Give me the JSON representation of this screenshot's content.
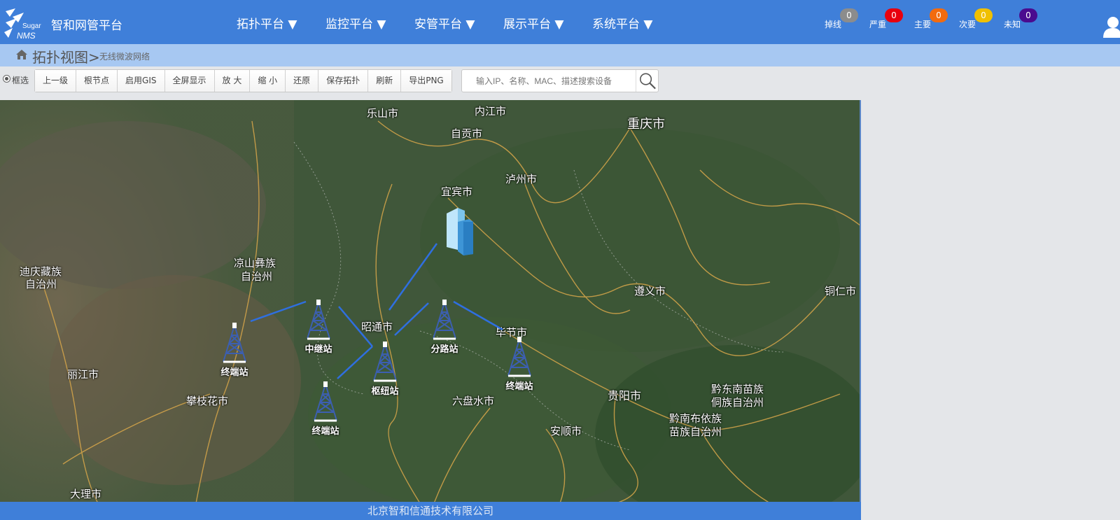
{
  "app": {
    "title": "智和网管平台",
    "logo_text_1": "Sugar",
    "logo_text_2": "NMS"
  },
  "nav": [
    {
      "label": "拓扑平台 ▼"
    },
    {
      "label": "监控平台 ▼"
    },
    {
      "label": "安管平台 ▼"
    },
    {
      "label": "展示平台 ▼"
    },
    {
      "label": "系统平台 ▼"
    }
  ],
  "alarms": [
    {
      "label": "掉线",
      "count": "0",
      "color": "#8c8c8c"
    },
    {
      "label": "严重",
      "count": "0",
      "color": "#e8000d"
    },
    {
      "label": "主要",
      "count": "0",
      "color": "#f26b0f"
    },
    {
      "label": "次要",
      "count": "0",
      "color": "#f0c000"
    },
    {
      "label": "未知",
      "count": "0",
      "color": "#4a0b8f"
    }
  ],
  "breadcrumb": {
    "main": "拓扑视图>",
    "sub": "无线微波网络"
  },
  "toolbar": {
    "select_label": "框选",
    "buttons": [
      "上一级",
      "根节点",
      "启用GIS",
      "全屏显示",
      "放 大",
      "缩 小",
      "还原",
      "保存拓扑",
      "刷新",
      "导出PNG"
    ],
    "search_placeholder": "输入IP、名称、MAC、描述搜索设备"
  },
  "map": {
    "cities": [
      "乐山市",
      "内江市",
      "重庆市",
      "自贡市",
      "泸州市",
      "宜宾市",
      "凉山彝族",
      "自治州",
      "迪庆藏族",
      "自治州",
      "遵义市",
      "铜仁市",
      "昭通市",
      "毕节市",
      "丽江市",
      "攀枝花市",
      "六盘水市",
      "贵阳市",
      "黔东南苗族",
      "侗族自治州",
      "黔南布依族",
      "苗族自治州",
      "安顺市",
      "大理市"
    ],
    "nodes": [
      {
        "id": "hub-building",
        "label": ""
      },
      {
        "id": "relay",
        "label": "中继站"
      },
      {
        "id": "branch",
        "label": "分路站"
      },
      {
        "id": "terminal-west",
        "label": "终端站"
      },
      {
        "id": "hub",
        "label": "枢纽站"
      },
      {
        "id": "terminal-east",
        "label": "终端站"
      },
      {
        "id": "terminal-south",
        "label": "终端站"
      }
    ]
  },
  "footer": {
    "text": "北京智和信通技术有限公司"
  },
  "colors": {
    "topbar": "#3f7fd9",
    "breadcrumb": "#a7c8f2",
    "link": "#2f6fe0"
  }
}
